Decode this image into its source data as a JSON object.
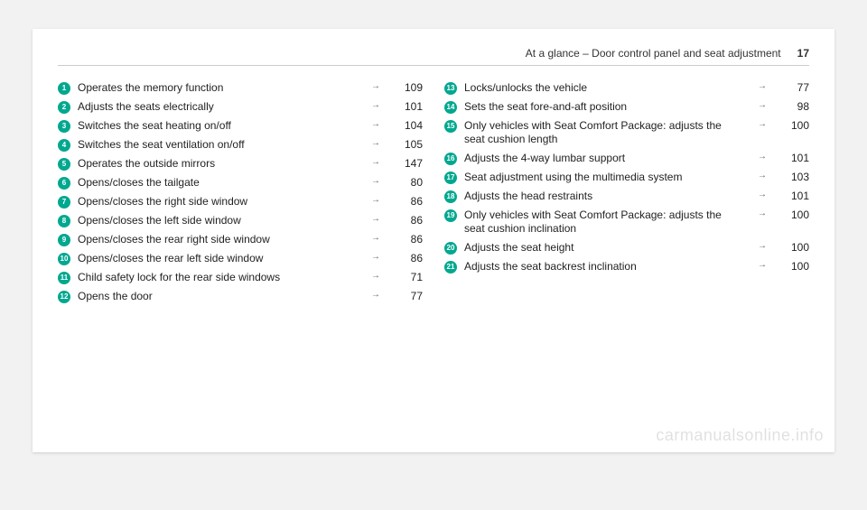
{
  "header": {
    "title": "At a glance – Door control panel and seat adjustment",
    "page_number": "17"
  },
  "arrow_glyph": "→",
  "left_column": [
    {
      "n": "1",
      "label": "Operates the memory function",
      "page": "109"
    },
    {
      "n": "2",
      "label": "Adjusts the seats electrically",
      "page": "101"
    },
    {
      "n": "3",
      "label": "Switches the seat heating on/off",
      "page": "104"
    },
    {
      "n": "4",
      "label": "Switches the seat ventilation on/off",
      "page": "105"
    },
    {
      "n": "5",
      "label": "Operates the outside mirrors",
      "page": "147"
    },
    {
      "n": "6",
      "label": "Opens/closes the tailgate",
      "page": "80"
    },
    {
      "n": "7",
      "label": "Opens/closes the right side window",
      "page": "86"
    },
    {
      "n": "8",
      "label": "Opens/closes the left side window",
      "page": "86"
    },
    {
      "n": "9",
      "label": "Opens/closes the rear right side window",
      "page": "86"
    },
    {
      "n": "10",
      "label": "Opens/closes the rear left side window",
      "page": "86"
    },
    {
      "n": "11",
      "label": "Child safety lock for the rear side windows",
      "page": "71"
    },
    {
      "n": "12",
      "label": "Opens the door",
      "page": "77"
    }
  ],
  "right_column": [
    {
      "n": "13",
      "label": "Locks/unlocks the vehicle",
      "page": "77"
    },
    {
      "n": "14",
      "label": "Sets the seat fore-and-aft position",
      "page": "98"
    },
    {
      "n": "15",
      "label": "Only vehicles with Seat Comfort Package: adjusts the seat cushion length",
      "page": "100"
    },
    {
      "n": "16",
      "label": "Adjusts the 4-way lumbar support",
      "page": "101"
    },
    {
      "n": "17",
      "label": "Seat adjustment using the multimedia system",
      "page": "103"
    },
    {
      "n": "18",
      "label": "Adjusts the head restraints",
      "page": "101"
    },
    {
      "n": "19",
      "label": "Only vehicles with Seat Comfort Package: adjusts the seat cushion inclination",
      "page": "100"
    },
    {
      "n": "20",
      "label": "Adjusts the seat height",
      "page": "100"
    },
    {
      "n": "21",
      "label": "Adjusts the seat backrest inclination",
      "page": "100"
    }
  ],
  "watermark": "carmanualsonline.info"
}
